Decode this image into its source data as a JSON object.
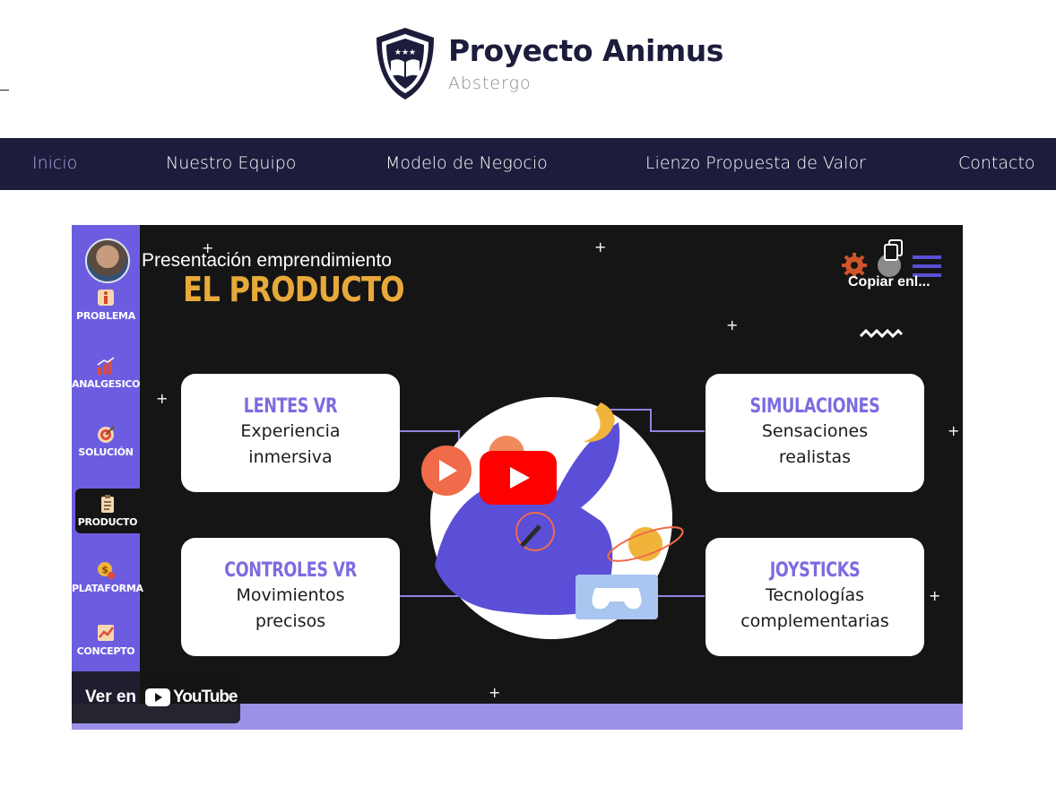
{
  "header": {
    "title": "Proyecto Animus",
    "subtitle": "Abstergo",
    "logo_icon": "shield-book-icon"
  },
  "nav": {
    "items": [
      {
        "label": "Inicio",
        "active": true
      },
      {
        "label": "Nuestro Equipo",
        "active": false
      },
      {
        "label": "Modelo de Negocio",
        "active": false
      },
      {
        "label": "Lienzo Propuesta de Valor",
        "active": false
      },
      {
        "label": "Contacto",
        "active": false
      }
    ],
    "bg_color": "#1c1c3c",
    "active_color": "#b9a6ee"
  },
  "video": {
    "title": "Presentación emprendimiento",
    "copy_label": "Copiar enl...",
    "watch_on": "Ver en",
    "youtube_word": "YouTube",
    "slide": {
      "heading": "EL PRODUCTO",
      "sidebar": [
        {
          "label": "PROBLEMA",
          "icon": "info-icon"
        },
        {
          "label": "ANALGESICO",
          "icon": "bar-chart-icon"
        },
        {
          "label": "SOLUCIÓN",
          "icon": "target-icon"
        },
        {
          "label": "PRODUCTO",
          "icon": "clipboard-icon",
          "active": true
        },
        {
          "label": "PLATAFORMA",
          "icon": "coin-icon"
        },
        {
          "label": "CONCEPTO",
          "icon": "trend-icon"
        }
      ],
      "cards": [
        {
          "title": "LENTES VR",
          "desc1": "Experiencia",
          "desc2": "inmersiva"
        },
        {
          "title": "SIMULACIONES",
          "desc1": "Sensaciones",
          "desc2": "realistas"
        },
        {
          "title": "CONTROLES VR",
          "desc1": "Movimientos",
          "desc2": "precisos"
        },
        {
          "title": "JOYSTICKS",
          "desc1": "Tecnologías",
          "desc2": "complementarias"
        }
      ]
    }
  }
}
